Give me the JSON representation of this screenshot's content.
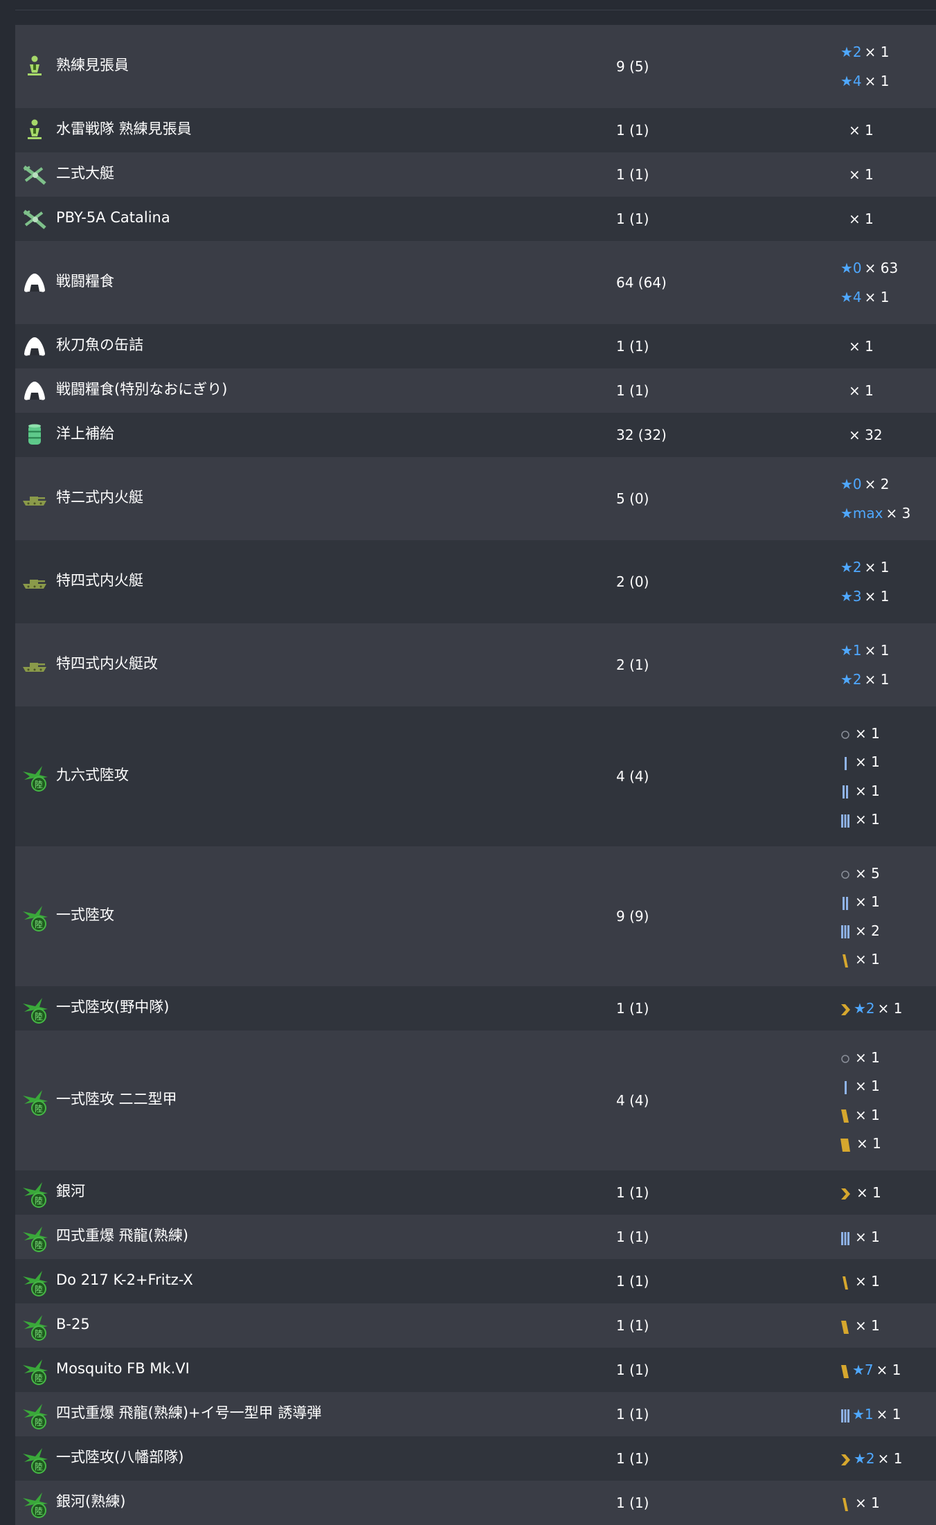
{
  "rows": [
    {
      "name": "熟練見張員",
      "count": "9 (5)",
      "icon": "lookout-icon",
      "prof": [
        {
          "lvl": "★2",
          "mark": "",
          "qty": "× 1"
        },
        {
          "lvl": "★4",
          "mark": "",
          "qty": "× 1"
        }
      ]
    },
    {
      "name": "水雷戦隊 熟練見張員",
      "count": "1 (1)",
      "icon": "lookout-icon",
      "prof": [
        {
          "lvl": "",
          "mark": "",
          "qty": "× 1"
        }
      ]
    },
    {
      "name": "二式大艇",
      "count": "1 (1)",
      "icon": "flying-boat-icon",
      "prof": [
        {
          "lvl": "",
          "mark": "",
          "qty": "× 1"
        }
      ]
    },
    {
      "name": "PBY-5A Catalina",
      "count": "1 (1)",
      "icon": "flying-boat-icon",
      "prof": [
        {
          "lvl": "",
          "mark": "",
          "qty": "× 1"
        }
      ]
    },
    {
      "name": "戦闘糧食",
      "count": "64 (64)",
      "icon": "ration-icon",
      "prof": [
        {
          "lvl": "★0",
          "mark": "",
          "qty": "× 63"
        },
        {
          "lvl": "★4",
          "mark": "",
          "qty": "× 1"
        }
      ]
    },
    {
      "name": "秋刀魚の缶詰",
      "count": "1 (1)",
      "icon": "ration-icon",
      "prof": [
        {
          "lvl": "",
          "mark": "",
          "qty": "× 1"
        }
      ]
    },
    {
      "name": "戦闘糧食(特別なおにぎり)",
      "count": "1 (1)",
      "icon": "ration-icon",
      "prof": [
        {
          "lvl": "",
          "mark": "",
          "qty": "× 1"
        }
      ]
    },
    {
      "name": "洋上補給",
      "count": "32 (32)",
      "icon": "supply-drum-icon",
      "prof": [
        {
          "lvl": "",
          "mark": "",
          "qty": "× 32"
        }
      ]
    },
    {
      "name": "特二式内火艇",
      "count": "5 (0)",
      "icon": "amphibious-tank-icon",
      "prof": [
        {
          "lvl": "★0",
          "mark": "",
          "qty": "× 2"
        },
        {
          "lvl": "★max",
          "mark": "",
          "qty": "× 3"
        }
      ]
    },
    {
      "name": "特四式内火艇",
      "count": "2 (0)",
      "icon": "amphibious-tank-icon",
      "prof": [
        {
          "lvl": "★2",
          "mark": "",
          "qty": "× 1"
        },
        {
          "lvl": "★3",
          "mark": "",
          "qty": "× 1"
        }
      ]
    },
    {
      "name": "特四式内火艇改",
      "count": "2 (1)",
      "icon": "amphibious-tank-icon",
      "prof": [
        {
          "lvl": "★1",
          "mark": "",
          "qty": "× 1"
        },
        {
          "lvl": "★2",
          "mark": "",
          "qty": "× 1"
        }
      ]
    },
    {
      "name": "九六式陸攻",
      "count": "4 (4)",
      "icon": "land-bomber-icon",
      "prof": [
        {
          "lvl": "",
          "mark": "none",
          "qty": "× 1"
        },
        {
          "lvl": "",
          "mark": "blue1",
          "qty": "× 1"
        },
        {
          "lvl": "",
          "mark": "blue2",
          "qty": "× 1"
        },
        {
          "lvl": "",
          "mark": "blue3",
          "qty": "× 1"
        }
      ]
    },
    {
      "name": "一式陸攻",
      "count": "9 (9)",
      "icon": "land-bomber-icon",
      "prof": [
        {
          "lvl": "",
          "mark": "none",
          "qty": "× 5"
        },
        {
          "lvl": "",
          "mark": "blue2",
          "qty": "× 1"
        },
        {
          "lvl": "",
          "mark": "blue3",
          "qty": "× 2"
        },
        {
          "lvl": "",
          "mark": "gold1",
          "qty": "× 1"
        }
      ]
    },
    {
      "name": "一式陸攻(野中隊)",
      "count": "1 (1)",
      "icon": "land-bomber-icon",
      "prof": [
        {
          "lvl": "★2",
          "mark": "chevron",
          "qty": "× 1"
        }
      ]
    },
    {
      "name": "一式陸攻 二二型甲",
      "count": "4 (4)",
      "icon": "land-bomber-icon",
      "prof": [
        {
          "lvl": "",
          "mark": "none",
          "qty": "× 1"
        },
        {
          "lvl": "",
          "mark": "blue1",
          "qty": "× 1"
        },
        {
          "lvl": "",
          "mark": "gold2",
          "qty": "× 1"
        },
        {
          "lvl": "",
          "mark": "gold3",
          "qty": "× 1"
        }
      ]
    },
    {
      "name": "銀河",
      "count": "1 (1)",
      "icon": "land-bomber-icon",
      "prof": [
        {
          "lvl": "",
          "mark": "chevron",
          "qty": "× 1"
        }
      ]
    },
    {
      "name": "四式重爆 飛龍(熟練)",
      "count": "1 (1)",
      "icon": "land-bomber-icon",
      "prof": [
        {
          "lvl": "",
          "mark": "blue3",
          "qty": "× 1"
        }
      ]
    },
    {
      "name": "Do 217 K-2+Fritz-X",
      "count": "1 (1)",
      "icon": "land-bomber-icon",
      "prof": [
        {
          "lvl": "",
          "mark": "gold1",
          "qty": "× 1"
        }
      ]
    },
    {
      "name": "B-25",
      "count": "1 (1)",
      "icon": "land-bomber-icon",
      "prof": [
        {
          "lvl": "",
          "mark": "gold2",
          "qty": "× 1"
        }
      ]
    },
    {
      "name": "Mosquito FB Mk.VI",
      "count": "1 (1)",
      "icon": "land-bomber-icon",
      "prof": [
        {
          "lvl": "★7",
          "mark": "gold2",
          "qty": "× 1"
        }
      ]
    },
    {
      "name": "四式重爆 飛龍(熟練)+イ号一型甲 誘導弾",
      "count": "1 (1)",
      "icon": "land-bomber-icon",
      "prof": [
        {
          "lvl": "★1",
          "mark": "blue3",
          "qty": "× 1"
        }
      ]
    },
    {
      "name": "一式陸攻(八幡部隊)",
      "count": "1 (1)",
      "icon": "land-bomber-icon",
      "prof": [
        {
          "lvl": "★2",
          "mark": "chevron",
          "qty": "× 1"
        }
      ]
    },
    {
      "name": "銀河(熟練)",
      "count": "1 (1)",
      "icon": "land-bomber-icon",
      "prof": [
        {
          "lvl": "",
          "mark": "gold1",
          "qty": "× 1"
        }
      ]
    }
  ],
  "colors": {
    "row_odd": "#3a3d46",
    "row_even": "#30343c",
    "star": "#4fa8ff",
    "blue_mark": "#8fb3e8",
    "gold_mark": "#d6a72e",
    "bomber_green": "#3aa83a",
    "lookout_green": "#a6d86a",
    "tank_olive": "#8a9a4a",
    "drum_teal": "#5ec98a"
  }
}
